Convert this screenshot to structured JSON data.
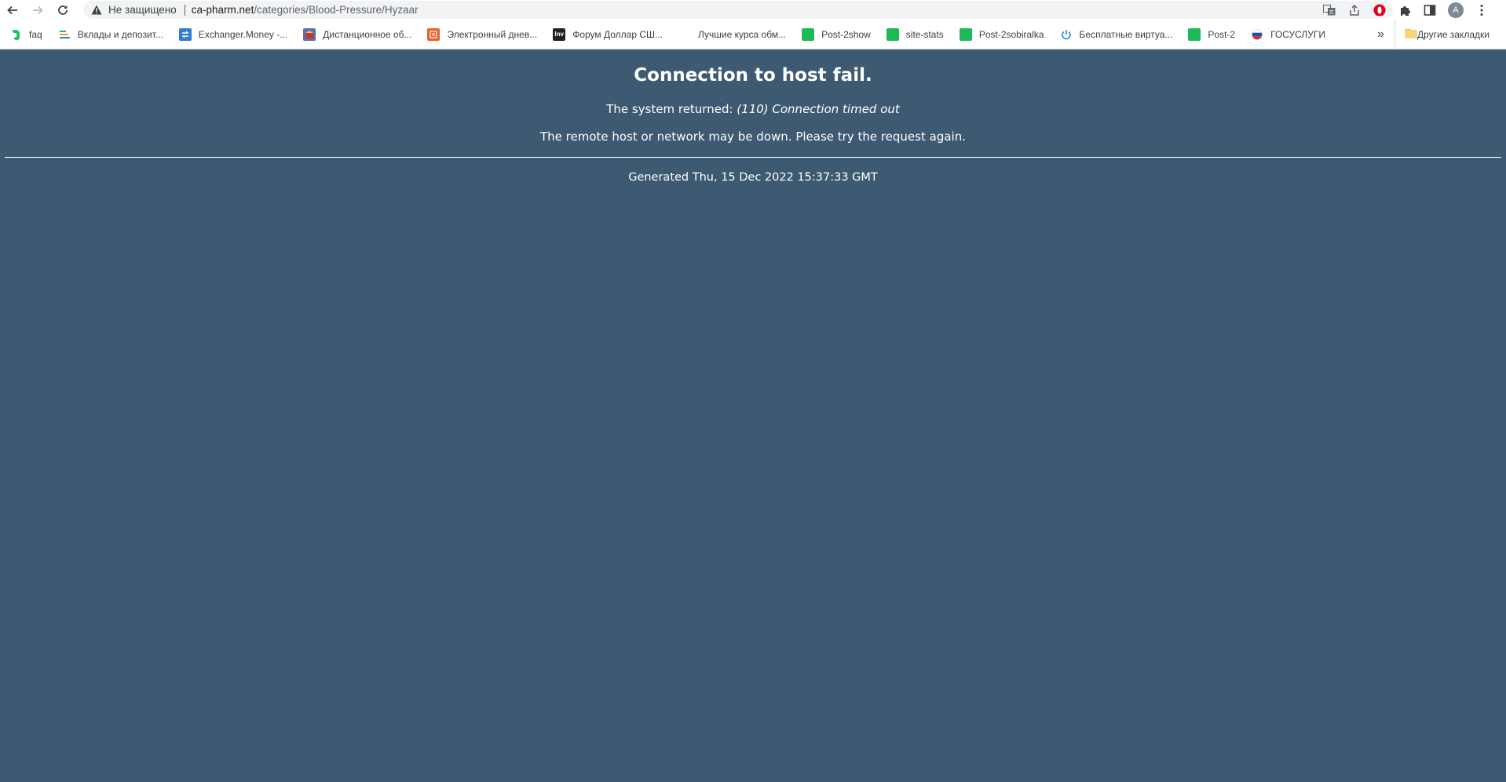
{
  "browser": {
    "security_label": "Не защищено",
    "url_host": "ca-pharm.net",
    "url_path": "/categories/Blood-Pressure/Hyzaar",
    "profile_initial": "A"
  },
  "bookmarks": [
    {
      "label": "faq",
      "icon": "evernote-icon",
      "color": "#2dbe60"
    },
    {
      "label": "Вклады и депозит...",
      "icon": "bars-icon",
      "color": "#f29d2a"
    },
    {
      "label": "Exchanger.Money -...",
      "icon": "exchange-icon",
      "color": "#2f7dd1"
    },
    {
      "label": "Дистанционное об...",
      "icon": "school-icon",
      "color": "#c0392b"
    },
    {
      "label": "Электронный днев...",
      "icon": "diary-icon",
      "color": "#e8632b"
    },
    {
      "label": "Форум Доллар СШ...",
      "icon": "inv-icon",
      "color": "#222222"
    },
    {
      "label": "Лучшие курса обм...",
      "icon": "moon-icon",
      "color": "#2bb3c0"
    },
    {
      "label": "Post-2show",
      "icon": "green-square-icon",
      "color": "#1db954"
    },
    {
      "label": "site-stats",
      "icon": "green-square-icon",
      "color": "#1db954"
    },
    {
      "label": "Post-2sobiralka",
      "icon": "green-square-icon",
      "color": "#1db954"
    },
    {
      "label": "Бесплатные виртуа...",
      "icon": "power-icon",
      "color": "#1e88e5"
    },
    {
      "label": "Post-2",
      "icon": "green-square-icon",
      "color": "#1db954"
    },
    {
      "label": "ГОСУСЛУГИ",
      "icon": "flag-icon",
      "color": "#d52b1e"
    }
  ],
  "bookmarks_other": "Другие закладки",
  "error_page": {
    "title": "Connection to host fail.",
    "returned_prefix": "The system returned: ",
    "returned_detail": "(110) Connection timed out",
    "message": "The remote host or network may be down. Please try the request again.",
    "generated": "Generated Thu, 15 Dec 2022 15:37:33 GMT",
    "background_color": "#3d5a72"
  }
}
